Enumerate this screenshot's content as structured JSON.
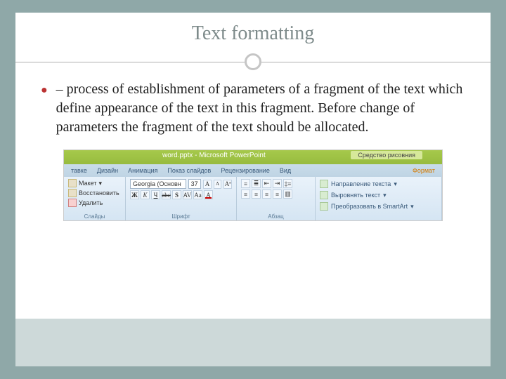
{
  "slide": {
    "title": "Text formatting",
    "body": "– process of establishment of parameters of a fragment of the text which define appearance of the text in this fragment. Before change of parameters the fragment of the text should be allocated."
  },
  "ribbon": {
    "titlebar": {
      "document": "word.pptx - Microsoft PowerPoint",
      "context_tab": "Средство рисовния"
    },
    "tabs": [
      "тавке",
      "Дизайн",
      "Анимация",
      "Показ слайдов",
      "Рецензирование",
      "Вид",
      "Формат"
    ],
    "clipboard": {
      "layout": "Макет",
      "reset": "Восстановить",
      "delete": "Удалить",
      "group_label": "Слайды"
    },
    "font": {
      "name": "Georgia (Основн",
      "size": "37",
      "group_label": "Шрифт"
    },
    "paragraph": {
      "group_label": "Абзац"
    },
    "right": {
      "text_direction": "Направление текста",
      "align_text": "Выровнять текст",
      "convert_smartart": "Преобразовать в SmartArt"
    }
  }
}
